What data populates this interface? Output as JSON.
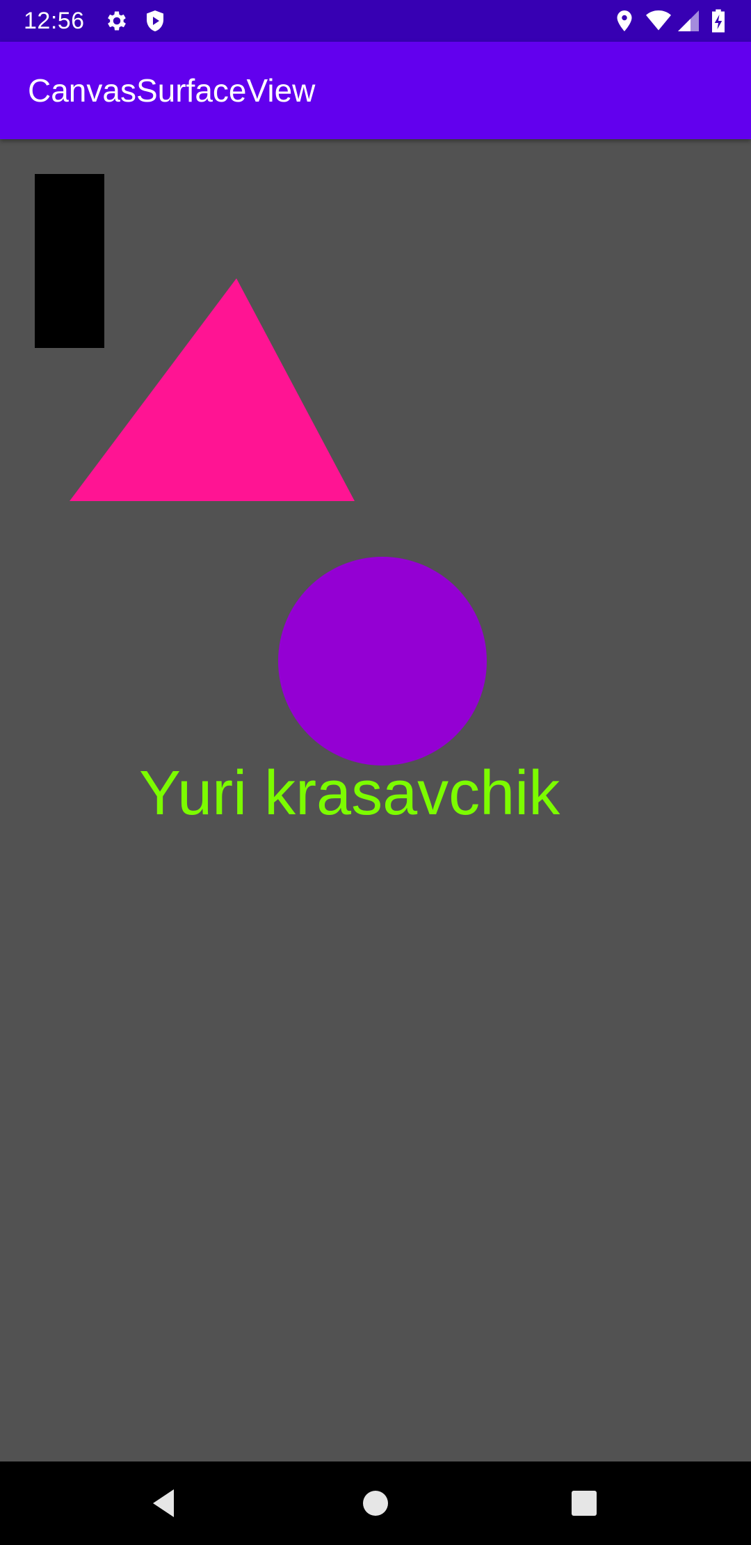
{
  "status_bar": {
    "time": "12:56",
    "icons": [
      "gear-icon",
      "shield-play-icon",
      "location-icon",
      "wifi-icon",
      "signal-icon",
      "battery-charging-icon"
    ],
    "color": "#3700b3"
  },
  "app_bar": {
    "title": "CanvasSurfaceView",
    "color": "#6200ee"
  },
  "canvas": {
    "background": "#525252",
    "text": "Yuri krasavchik",
    "colors": {
      "rectangle": "#000000",
      "triangle": "#ff1493",
      "circle": "#9400d3",
      "text": "#7cfc00"
    }
  },
  "nav_bar": {
    "buttons": [
      "back-icon",
      "home-icon",
      "recents-icon"
    ]
  }
}
